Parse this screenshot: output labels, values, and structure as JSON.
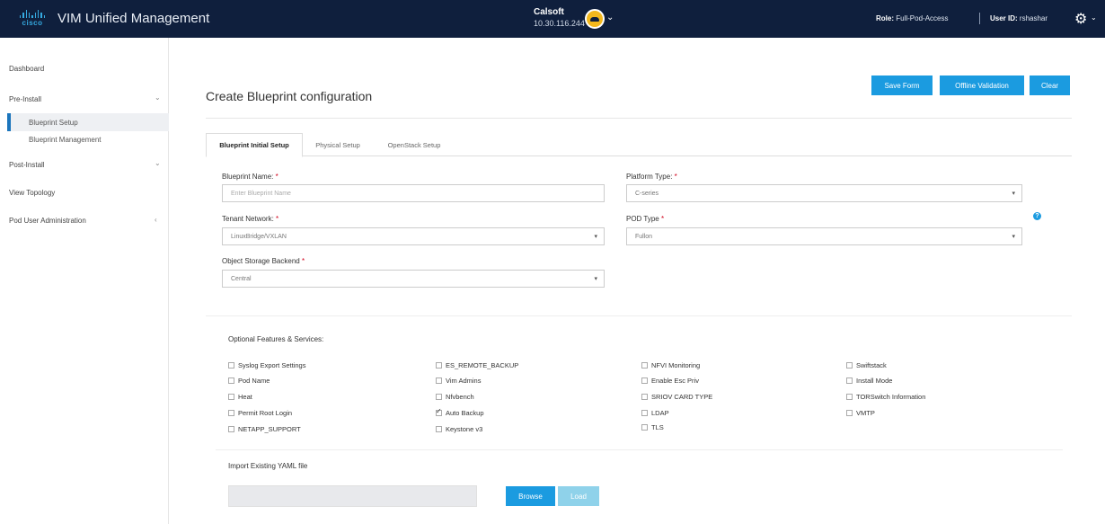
{
  "header": {
    "brand": "cisco",
    "app_title": "VIM Unified Management",
    "pod_name": "Calsoft",
    "pod_ip": "10.30.116.244",
    "role_label": "Role:",
    "role_value": "Full-Pod-Access",
    "user_label": "User ID:",
    "user_value": "rshashar",
    "cloud_status_color": "#f3b81d"
  },
  "sidebar": {
    "items": [
      {
        "label": "Dashboard"
      },
      {
        "label": "Pre-Install"
      },
      {
        "label": "Blueprint Setup"
      },
      {
        "label": "Blueprint Management"
      },
      {
        "label": "Post-Install"
      },
      {
        "label": "View Topology"
      },
      {
        "label": "Pod User Administration"
      }
    ]
  },
  "main": {
    "title": "Create Blueprint configuration",
    "buttons": {
      "save": "Save Form",
      "offline": "Offline Validation",
      "clear": "Clear"
    },
    "tabs": [
      {
        "label": "Blueprint Initial Setup"
      },
      {
        "label": "Physical Setup"
      },
      {
        "label": "OpenStack Setup"
      }
    ],
    "form": {
      "blueprint_name_label": "Blueprint Name:",
      "blueprint_name_placeholder": "Enter Blueprint Name",
      "platform_type_label": "Platform Type:",
      "platform_type_value": "C-series",
      "tenant_network_label": "Tenant Network:",
      "tenant_network_value": "LinuxBridge/VXLAN",
      "pod_type_label": "POD Type",
      "pod_type_value": "Fullon",
      "object_storage_label": "Object Storage Backend",
      "object_storage_value": "Central",
      "required_mark": "*"
    },
    "optional": {
      "heading": "Optional Features & Services:",
      "options": [
        {
          "label": "Syslog Export Settings",
          "checked": false
        },
        {
          "label": "Pod Name",
          "checked": false
        },
        {
          "label": "Heat",
          "checked": false
        },
        {
          "label": "Permit Root Login",
          "checked": false
        },
        {
          "label": "NETAPP_SUPPORT",
          "checked": false
        },
        {
          "label": "ES_REMOTE_BACKUP",
          "checked": false
        },
        {
          "label": "Vim Admins",
          "checked": false
        },
        {
          "label": "Nfvbench",
          "checked": false
        },
        {
          "label": "Auto Backup",
          "checked": true
        },
        {
          "label": "Keystone v3",
          "checked": false
        },
        {
          "label": "NFVI Monitoring",
          "checked": false
        },
        {
          "label": "Enable Esc Priv",
          "checked": false
        },
        {
          "label": "SRIOV CARD TYPE",
          "checked": false
        },
        {
          "label": "LDAP",
          "checked": false
        },
        {
          "label": "TLS",
          "checked": false
        },
        {
          "label": "Swiftstack",
          "checked": false
        },
        {
          "label": "Install Mode",
          "checked": false
        },
        {
          "label": "TORSwitch Information",
          "checked": false
        },
        {
          "label": "VMTP",
          "checked": false
        }
      ]
    },
    "import": {
      "label": "Import Existing YAML file",
      "browse": "Browse",
      "load": "Load"
    }
  }
}
